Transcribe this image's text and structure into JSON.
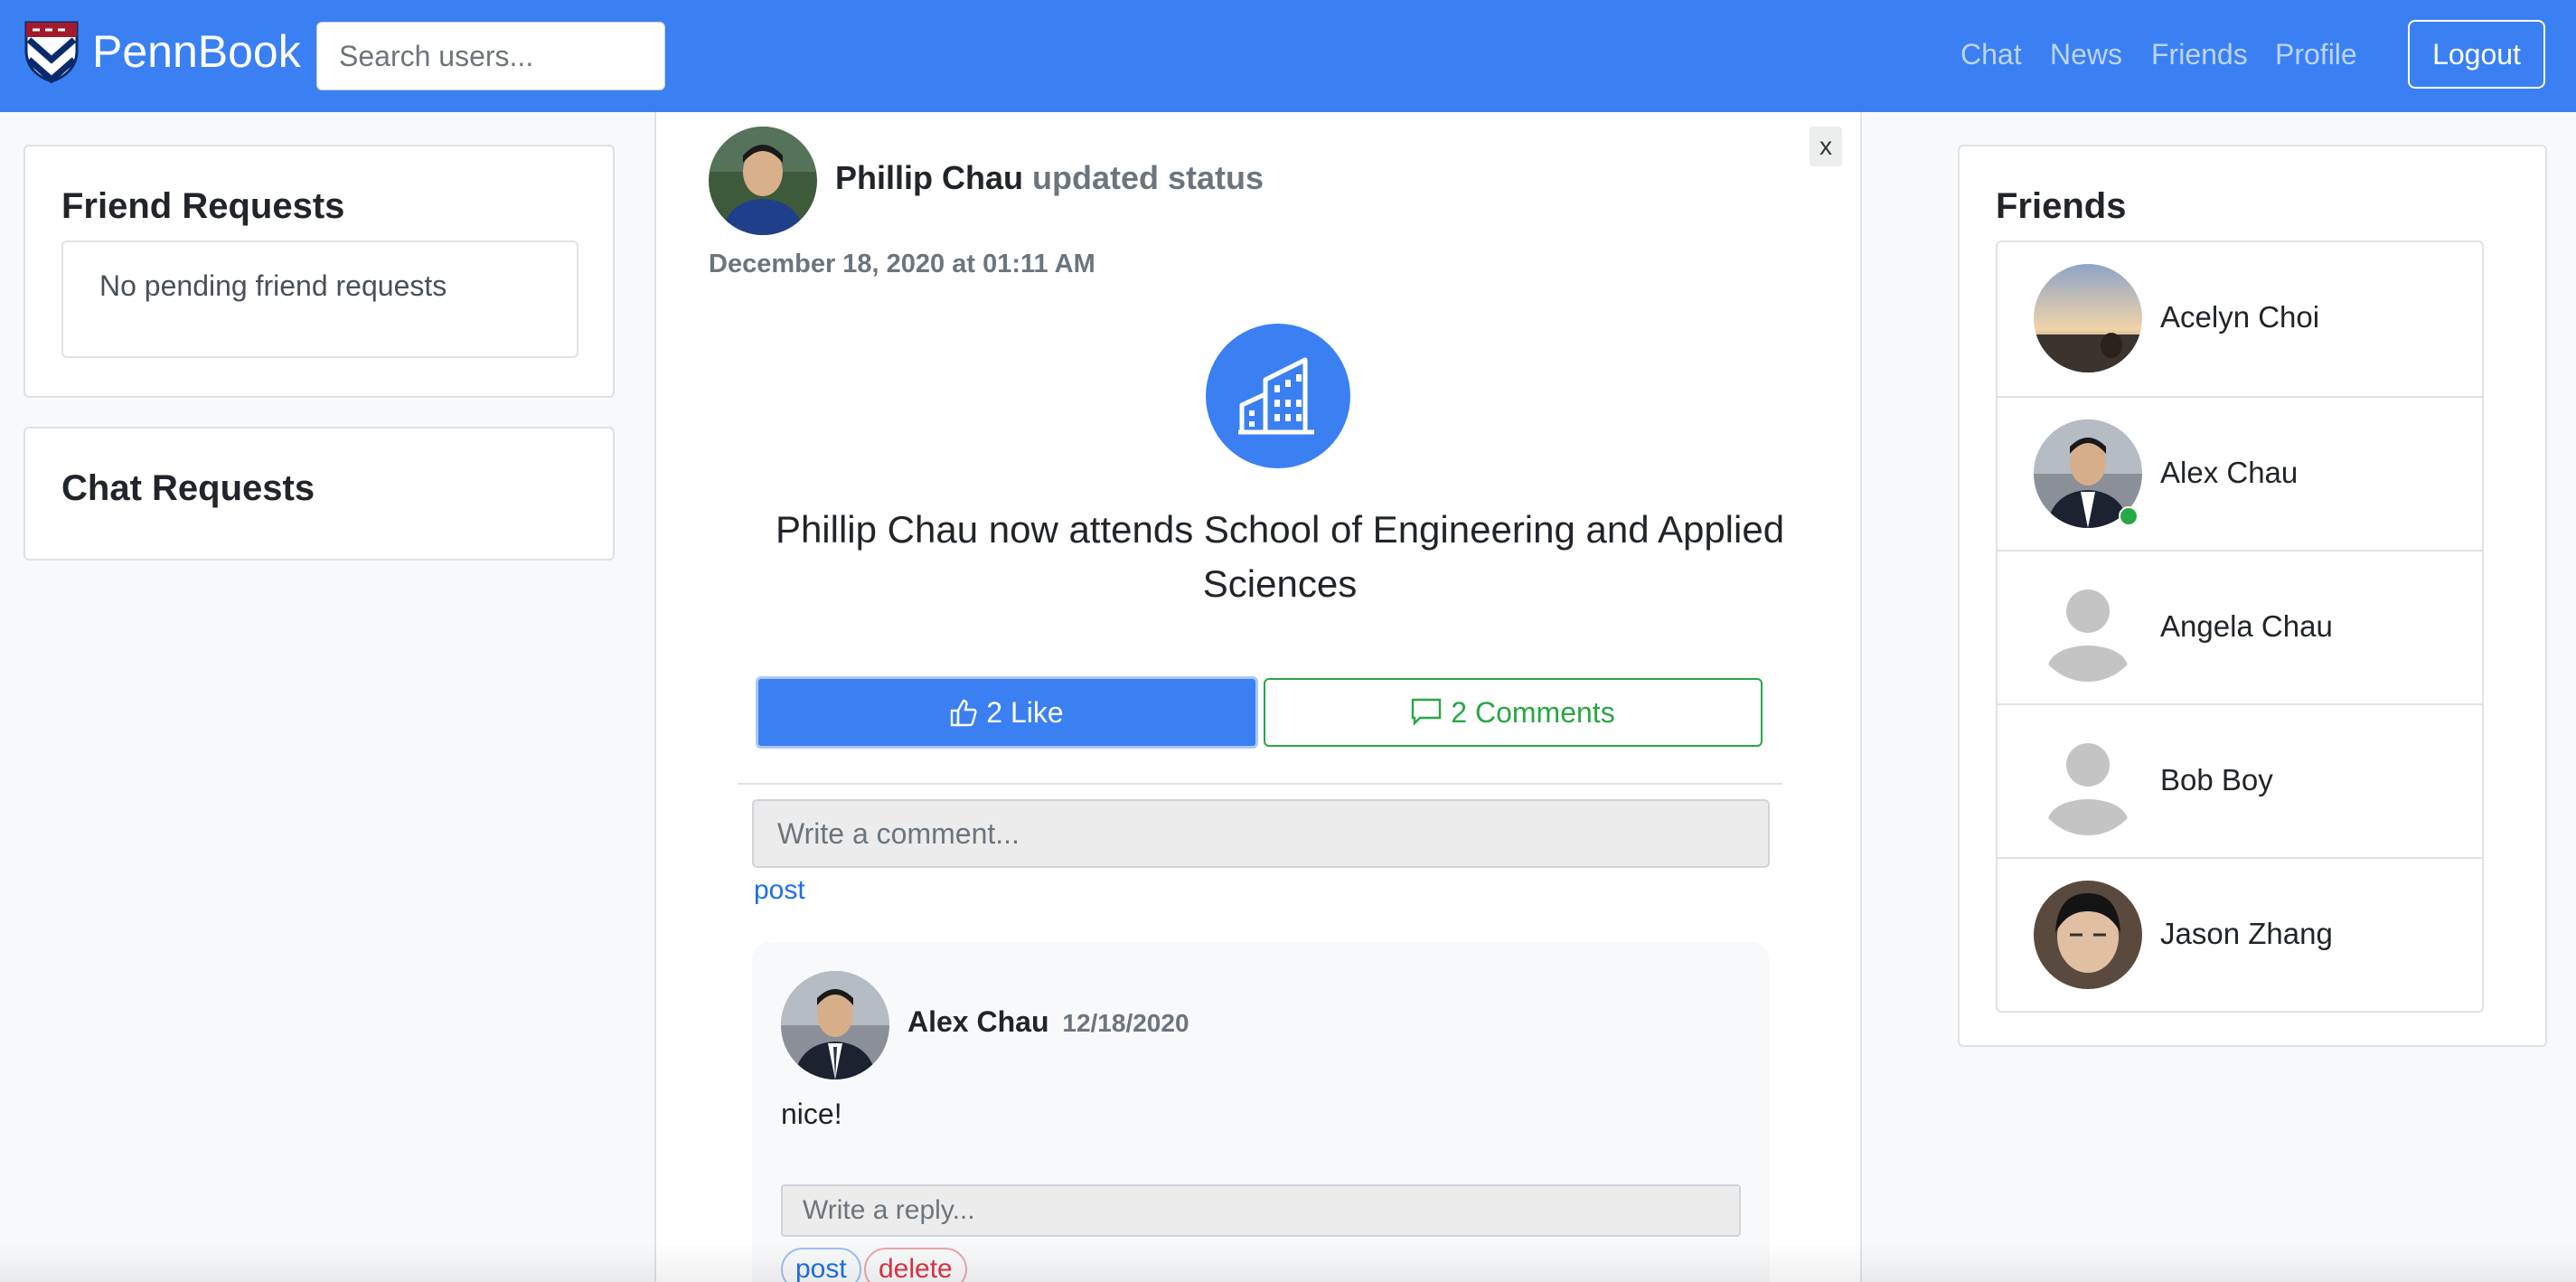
{
  "navbar": {
    "brand": "PennBook",
    "search_placeholder": "Search users...",
    "links": [
      "Chat",
      "News",
      "Friends",
      "Profile"
    ],
    "logout_label": "Logout",
    "brand_color": "#3a80f2"
  },
  "friend_requests": {
    "title": "Friend Requests",
    "empty_text": "No pending friend requests"
  },
  "chat_requests": {
    "title": "Chat Requests"
  },
  "post": {
    "author": "Phillip Chau",
    "action": "updated status",
    "date": "December 18, 2020 at 01:11 AM",
    "close_label": "x",
    "icon": "building-icon",
    "status_text": "Phillip Chau now attends School of Engineering and Applied Sciences",
    "like_label": "2 Like",
    "comments_label": "2 Comments",
    "comment_placeholder": "Write a comment...",
    "post_label": "post"
  },
  "comment": {
    "author": "Alex Chau",
    "date": "12/18/2020",
    "text": "nice!",
    "reply_placeholder": "Write a reply...",
    "post_label": "post",
    "delete_label": "delete"
  },
  "friends": {
    "title": "Friends",
    "items": [
      {
        "name": "Acelyn Choi",
        "online": false
      },
      {
        "name": "Alex Chau",
        "online": true
      },
      {
        "name": "Angela Chau",
        "online": false
      },
      {
        "name": "Bob Boy",
        "online": false
      },
      {
        "name": "Jason Zhang",
        "online": false
      }
    ]
  }
}
